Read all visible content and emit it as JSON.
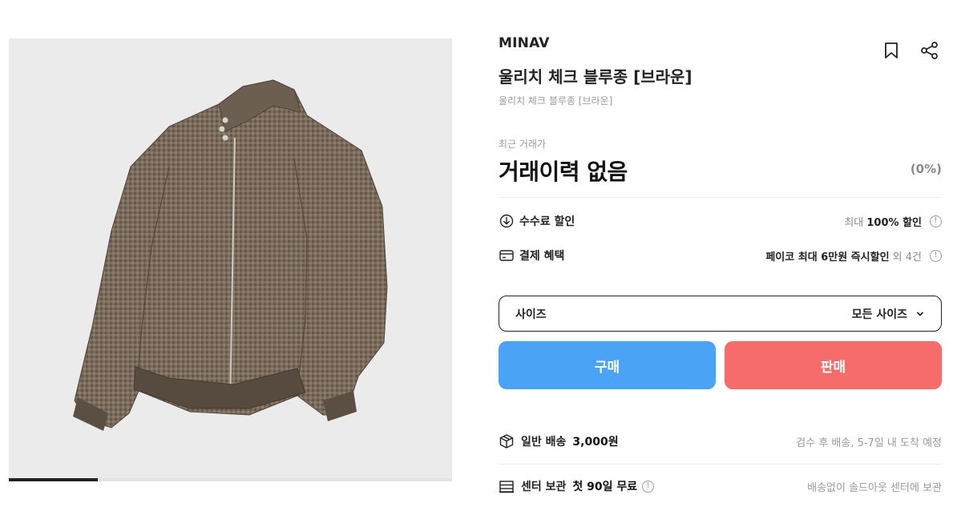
{
  "product": {
    "brand": "MINAV",
    "title": "울리치 체크 블루종 [브라운]",
    "subtitle": "울리치 체크 블루종 [브라운]",
    "image_carousel_progress": 0.2
  },
  "actions": {
    "bookmark_icon": "bookmark-icon",
    "share_icon": "share-icon"
  },
  "recent_trade": {
    "label": "최근 거래가",
    "price": "거래이력 없음",
    "change": "(0%)"
  },
  "benefits": [
    {
      "icon": "coupon-arrow-icon",
      "label": "수수료 할인",
      "prefix": "최대",
      "value": "100% 할인",
      "suffix": ""
    },
    {
      "icon": "card-icon",
      "label": "결제 혜택",
      "prefix": "",
      "value": "페이코 최대 6만원 즉시할인",
      "suffix": "외 4건"
    }
  ],
  "size_selector": {
    "label": "사이즈",
    "selected": "모든 사이즈"
  },
  "buttons": {
    "buy": "구매",
    "sell": "판매"
  },
  "shipping": [
    {
      "icon": "box-icon",
      "label": "일반 배송",
      "value": "3,000원",
      "note": "검수 후 배송, 5-7일 내 도착 예정"
    },
    {
      "icon": "warehouse-icon",
      "label": "센터 보관",
      "value": "첫 90일 무료",
      "note": "배송없이 솔드아웃 센터에 보관"
    }
  ],
  "colors": {
    "buy": "#4aa3f5",
    "sell": "#f66c6b",
    "text": "#222222",
    "muted": "#9a9a9a"
  }
}
